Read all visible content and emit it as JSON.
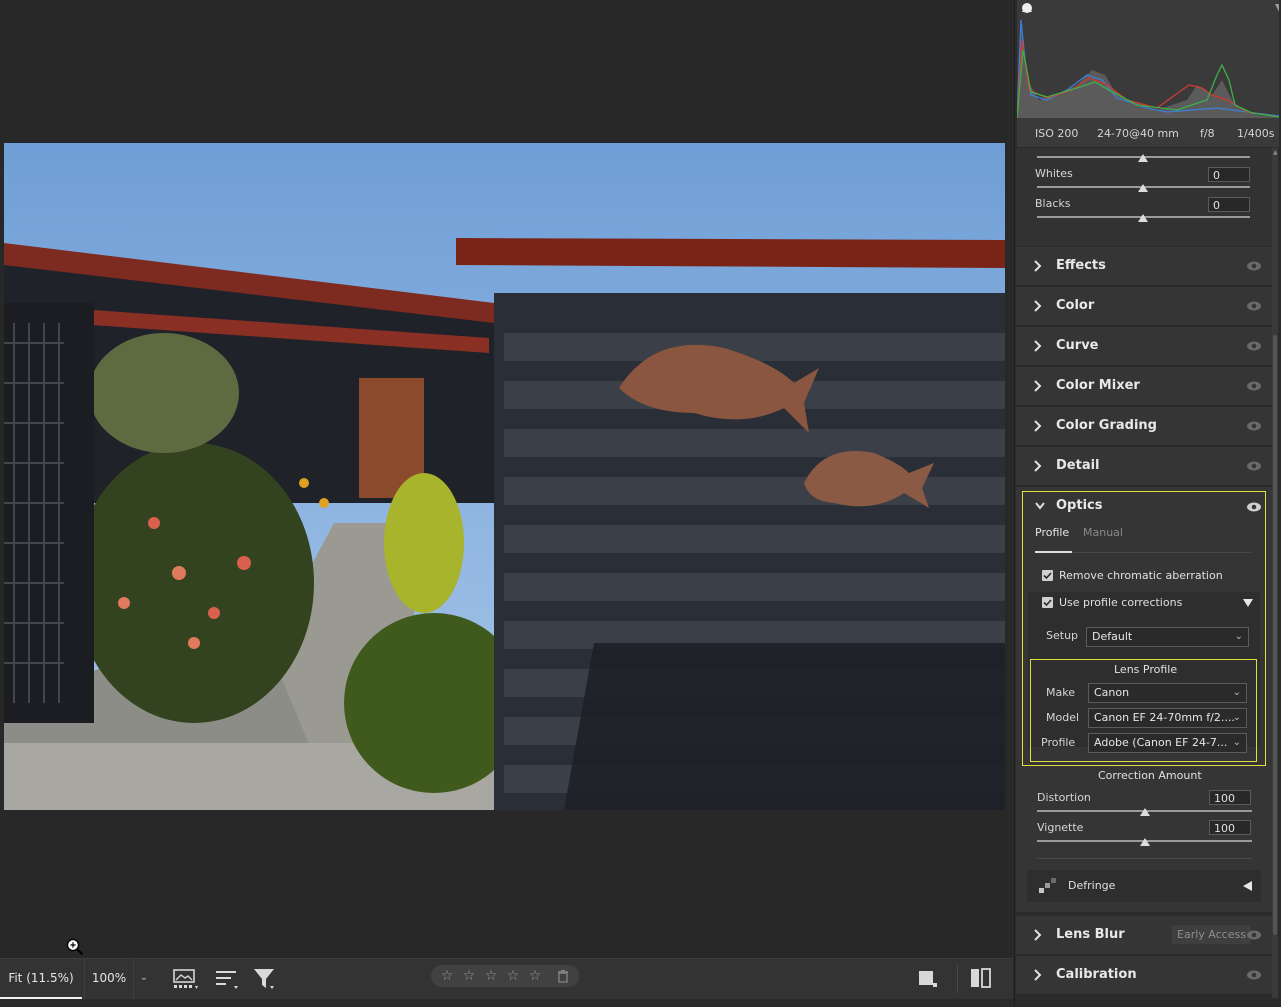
{
  "zoom": {
    "fit_label": "Fit (11.5%)",
    "hundred_label": "100%"
  },
  "camera_info": {
    "iso": "ISO 200",
    "lens": "24-70@40 mm",
    "aperture": "f/8",
    "shutter": "1/400s"
  },
  "basic": {
    "whites": {
      "label": "Whites",
      "value": "0"
    },
    "blacks": {
      "label": "Blacks",
      "value": "0"
    }
  },
  "sections": {
    "effects": "Effects",
    "color": "Color",
    "curve": "Curve",
    "color_mixer": "Color Mixer",
    "color_grading": "Color Grading",
    "detail": "Detail",
    "optics": "Optics",
    "lens_blur": "Lens Blur",
    "calibration": "Calibration"
  },
  "lens_blur_badge": "Early Access",
  "optics": {
    "tabs": [
      "Profile",
      "Manual"
    ],
    "active_tab": "Profile",
    "remove_ca": "Remove chromatic aberration",
    "use_profile": "Use profile corrections",
    "setup_label": "Setup",
    "setup_value": "Default",
    "lens_profile_title": "Lens Profile",
    "make_label": "Make",
    "make_value": "Canon",
    "model_label": "Model",
    "model_value": "Canon EF 24-70mm f/2....",
    "profile_label": "Profile",
    "profile_value": "Adobe (Canon EF 24-7...",
    "correction_amount": "Correction Amount",
    "distortion_label": "Distortion",
    "distortion_value": "100",
    "vignette_label": "Vignette",
    "vignette_value": "100",
    "defringe": "Defringe"
  },
  "rating": {
    "stars": 0,
    "max": 5
  },
  "colors": {
    "highlight": "#e0e040",
    "panel": "#2b2b2b",
    "section": "#353535"
  },
  "icons": [
    "zoom-in-icon",
    "filmstrip-icon",
    "sort-icon",
    "filter-icon",
    "star-icon",
    "trash-icon",
    "fullscreen-icon",
    "compare-icon",
    "eye-icon",
    "chevron-right-icon",
    "chevron-down-icon",
    "defringe-icon"
  ]
}
